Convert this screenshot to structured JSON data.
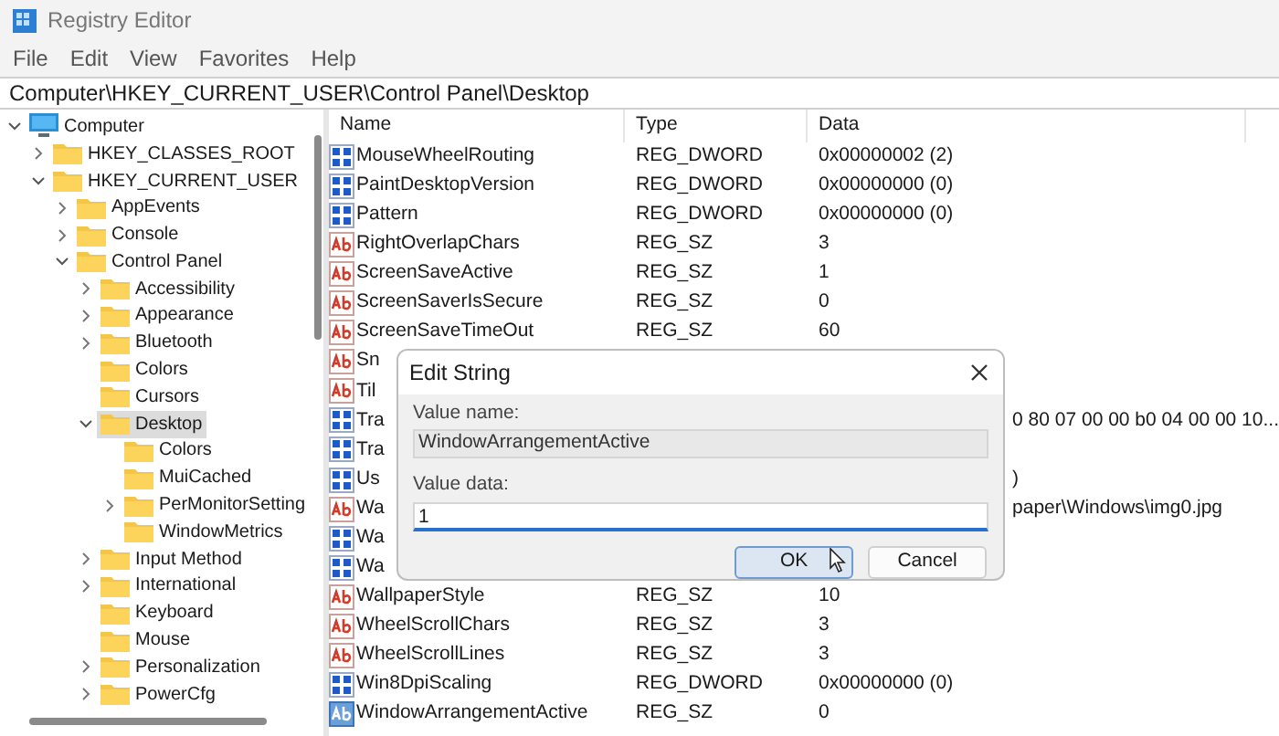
{
  "window": {
    "title": "Registry Editor"
  },
  "menu": [
    "File",
    "Edit",
    "View",
    "Favorites",
    "Help"
  ],
  "address": "Computer\\HKEY_CURRENT_USER\\Control Panel\\Desktop",
  "tree": [
    {
      "label": "Computer",
      "kind": "root",
      "selected": false,
      "children": [
        {
          "label": "HKEY_CLASSES_ROOT",
          "kind": "closed",
          "selected": false
        },
        {
          "label": "HKEY_CURRENT_USER",
          "kind": "open",
          "selected": false,
          "children": [
            {
              "label": "AppEvents",
              "kind": "closed",
              "selected": false
            },
            {
              "label": "Console",
              "kind": "closed",
              "selected": false
            },
            {
              "label": "Control Panel",
              "kind": "open",
              "selected": false,
              "children": [
                {
                  "label": "Accessibility",
                  "kind": "closed",
                  "selected": false
                },
                {
                  "label": "Appearance",
                  "kind": "closed",
                  "selected": false
                },
                {
                  "label": "Bluetooth",
                  "kind": "closed",
                  "selected": false
                },
                {
                  "label": "Colors",
                  "kind": "leaf",
                  "selected": false
                },
                {
                  "label": "Cursors",
                  "kind": "leaf",
                  "selected": false
                },
                {
                  "label": "Desktop",
                  "kind": "open",
                  "selected": true,
                  "children": [
                    {
                      "label": "Colors",
                      "kind": "leaf",
                      "selected": false
                    },
                    {
                      "label": "MuiCached",
                      "kind": "leaf",
                      "selected": false
                    },
                    {
                      "label": "PerMonitorSetting",
                      "kind": "closed",
                      "selected": false
                    },
                    {
                      "label": "WindowMetrics",
                      "kind": "leaf",
                      "selected": false
                    }
                  ]
                },
                {
                  "label": "Input Method",
                  "kind": "closed",
                  "selected": false
                },
                {
                  "label": "International",
                  "kind": "closed",
                  "selected": false
                },
                {
                  "label": "Keyboard",
                  "kind": "leaf",
                  "selected": false
                },
                {
                  "label": "Mouse",
                  "kind": "leaf",
                  "selected": false
                },
                {
                  "label": "Personalization",
                  "kind": "closed",
                  "selected": false
                },
                {
                  "label": "PowerCfg",
                  "kind": "closed",
                  "selected": false
                }
              ]
            }
          ]
        }
      ]
    }
  ],
  "table": {
    "columns": [
      "Name",
      "Type",
      "Data"
    ],
    "rows": [
      {
        "kind": "dword",
        "name": "MouseWheelRouting",
        "type": "REG_DWORD",
        "data": "0x00000002 (2)",
        "selected": false
      },
      {
        "kind": "dword",
        "name": "PaintDesktopVersion",
        "type": "REG_DWORD",
        "data": "0x00000000 (0)",
        "selected": false
      },
      {
        "kind": "dword",
        "name": "Pattern",
        "type": "REG_DWORD",
        "data": "0x00000000 (0)",
        "selected": false
      },
      {
        "kind": "string",
        "name": "RightOverlapChars",
        "type": "REG_SZ",
        "data": "3",
        "selected": false
      },
      {
        "kind": "string",
        "name": "ScreenSaveActive",
        "type": "REG_SZ",
        "data": "1",
        "selected": false
      },
      {
        "kind": "string",
        "name": "ScreenSaverIsSecure",
        "type": "REG_SZ",
        "data": "0",
        "selected": false
      },
      {
        "kind": "string",
        "name": "ScreenSaveTimeOut",
        "type": "REG_SZ",
        "data": "60",
        "selected": false
      },
      {
        "kind": "string",
        "name": "Sn",
        "selected": false
      },
      {
        "kind": "string",
        "name": "Til",
        "selected": false
      },
      {
        "kind": "dword",
        "name": "Tra",
        "data": "0 80 07 00 00 b0 04 00 00 10...",
        "selected": false
      },
      {
        "kind": "dword",
        "name": "Tra",
        "selected": false
      },
      {
        "kind": "dword",
        "name": "Us",
        "data": ")",
        "selected": false
      },
      {
        "kind": "string",
        "name": "Wa",
        "data": "paper\\Windows\\img0.jpg",
        "selected": false
      },
      {
        "kind": "dword",
        "name": "Wa",
        "selected": false
      },
      {
        "kind": "dword",
        "name": "Wa",
        "selected": false
      },
      {
        "kind": "string",
        "name": "WallpaperStyle",
        "type": "REG_SZ",
        "data": "10",
        "selected": false
      },
      {
        "kind": "string",
        "name": "WheelScrollChars",
        "type": "REG_SZ",
        "data": "3",
        "selected": false
      },
      {
        "kind": "string",
        "name": "WheelScrollLines",
        "type": "REG_SZ",
        "data": "3",
        "selected": false
      },
      {
        "kind": "dword",
        "name": "Win8DpiScaling",
        "type": "REG_DWORD",
        "data": "0x00000000 (0)",
        "selected": false
      },
      {
        "kind": "string",
        "name": "WindowArrangementActive",
        "type": "REG_SZ",
        "data": "0",
        "selected": true
      }
    ]
  },
  "dialog": {
    "title": "Edit String",
    "value_name_label": "Value name:",
    "value_name": "WindowArrangementActive",
    "value_data_label": "Value data:",
    "value_data": "1",
    "buttons": [
      {
        "label": "OK",
        "selected": true
      },
      {
        "label": "Cancel",
        "selected": false
      }
    ]
  }
}
